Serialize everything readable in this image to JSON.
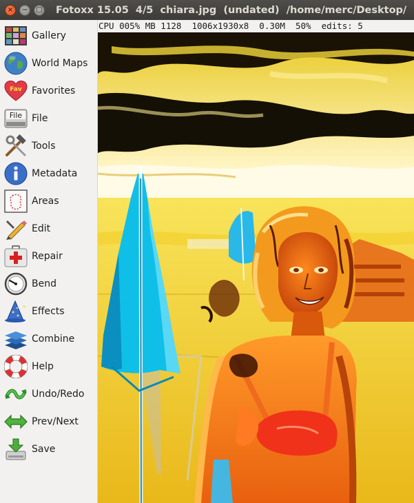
{
  "window": {
    "title": "Fotoxx 15.05  4/5  chiara.jpg  (undated)  /home/merc/Desktop/",
    "close_icon": "×",
    "minimize_icon": "−",
    "maximize_icon": "□"
  },
  "status": {
    "text": "CPU 005% MB 1128  1006x1930x8  0.30M  50%  edits: 5"
  },
  "menu": [
    {
      "label": "Gallery",
      "icon": "gallery-icon"
    },
    {
      "label": "World Maps",
      "icon": "globe-icon"
    },
    {
      "label": "Favorites",
      "icon": "heart-icon"
    },
    {
      "label": "File",
      "icon": "file-icon"
    },
    {
      "label": "Tools",
      "icon": "tools-icon"
    },
    {
      "label": "Metadata",
      "icon": "info-icon"
    },
    {
      "label": "Areas",
      "icon": "areas-icon"
    },
    {
      "label": "Edit",
      "icon": "pencil-icon"
    },
    {
      "label": "Repair",
      "icon": "firstaid-icon"
    },
    {
      "label": "Bend",
      "icon": "gauge-icon"
    },
    {
      "label": "Effects",
      "icon": "wizard-hat-icon"
    },
    {
      "label": "Combine",
      "icon": "layers-icon"
    },
    {
      "label": "Help",
      "icon": "lifebuoy-icon"
    },
    {
      "label": "Undo/Redo",
      "icon": "undo-redo-icon"
    },
    {
      "label": "Prev/Next",
      "icon": "prev-next-icon"
    },
    {
      "label": "Save",
      "icon": "save-icon"
    }
  ],
  "file_icon_text": "File",
  "favorites_icon_text": "Fav"
}
